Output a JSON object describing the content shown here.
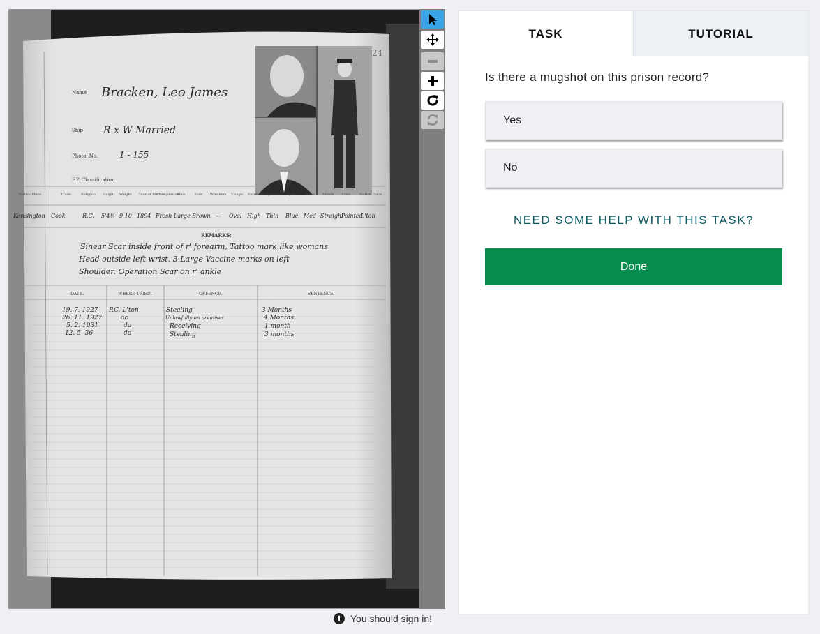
{
  "viewer": {
    "tools": [
      {
        "name": "pointer-tool",
        "icon": "arrow-cursor-icon",
        "state": "active"
      },
      {
        "name": "pan-tool",
        "icon": "move-arrows-icon",
        "state": "normal"
      },
      {
        "name": "zoom-out-tool",
        "icon": "minus-icon",
        "state": "disabled"
      },
      {
        "name": "zoom-in-tool",
        "icon": "plus-icon",
        "state": "normal"
      },
      {
        "name": "rotate-tool",
        "icon": "rotate-icon",
        "state": "normal"
      },
      {
        "name": "reset-tool",
        "icon": "refresh-icon",
        "state": "disabled"
      }
    ],
    "record": {
      "page_number": "24",
      "name_label": "Name",
      "name_value": "Bracken, Leo James",
      "ship_label": "Ship",
      "ship_value": "R x W Married",
      "photo_label": "Photo. No.",
      "photo_value": "1 - 155",
      "fp_label": "F.P. Classification",
      "columns": [
        "Native Place",
        "Trade",
        "Religion",
        "Height",
        "Weight",
        "Year of Birth",
        "Com-plexion",
        "Head",
        "Hair",
        "Whiskers",
        "Visage",
        "Forehead",
        "Eyebrows",
        "Eyes",
        "Nose",
        "Mouth",
        "Chin",
        "Native Place"
      ],
      "row": [
        "Kensington",
        "Cook",
        "R.C.",
        "5'4¾",
        "9.10",
        "1894",
        "Fresh",
        "Large",
        "Brown",
        "—",
        "Oval",
        "High",
        "Thin",
        "Blue",
        "Med",
        "Straight",
        "Pointed",
        "L'ton"
      ],
      "remarks_label": "REMARKS:",
      "remarks_lines": [
        "Sinear Scar inside front of r' forearm, Tattoo mark like womans",
        "Head outside left wrist. 3 Large Vaccine marks on left",
        "Shoulder. Operation Scar on r' ankle"
      ],
      "sentence_headers": [
        "DATE.",
        "WHERE TRIED.",
        "OFFENCE.",
        "SENTENCE."
      ],
      "sentences": [
        [
          "19. 7. 1927",
          "P.C. L'ton",
          "Stealing",
          "3 Months"
        ],
        [
          "26. 11. 1927",
          "do",
          "Unlawfully on premises",
          "4 Months"
        ],
        [
          "5. 2. 1931",
          "do",
          "Receiving",
          "1 month"
        ],
        [
          "12. 5. 36",
          "do",
          "Stealing",
          "3 months"
        ]
      ]
    }
  },
  "signin": {
    "icon": "info-icon",
    "text": "You should sign in!"
  },
  "panel": {
    "tabs": [
      {
        "label": "TASK",
        "active": true
      },
      {
        "label": "TUTORIAL",
        "active": false
      }
    ],
    "question": "Is there a mugshot on this prison record?",
    "answers": [
      "Yes",
      "No"
    ],
    "help_label": "NEED SOME HELP WITH THIS TASK?",
    "done_label": "Done"
  },
  "colors": {
    "active_tool": "#3aa5e6",
    "done_button": "#078e4f",
    "help_link": "#0b5a63"
  }
}
